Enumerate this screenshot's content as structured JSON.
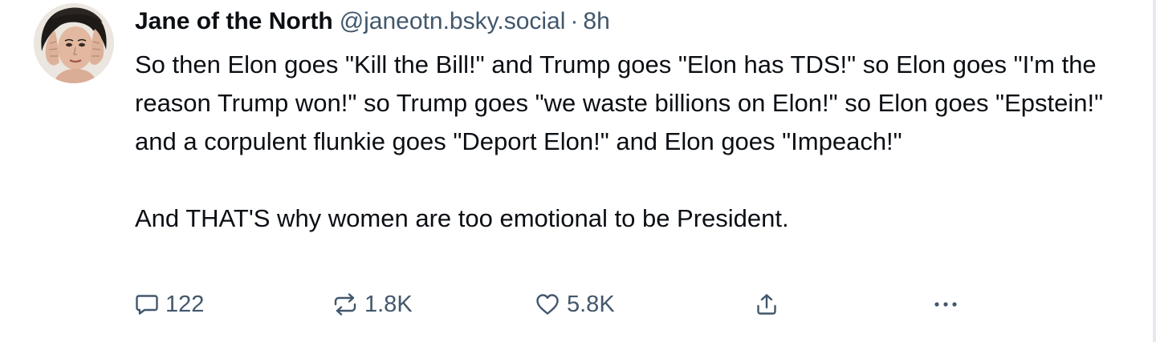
{
  "post": {
    "author": {
      "display_name": "Jane of the North",
      "handle": "@janeotn.bsky.social",
      "separator": "·",
      "time_ago": "8h"
    },
    "text": {
      "paragraph_1": "So then Elon goes \"Kill the Bill!\" and Trump goes \"Elon has TDS!\" so Elon goes \"I'm the reason Trump won!\" so Trump goes \"we waste billions on Elon!\" so Elon goes \"Epstein!\" and a corpulent flunkie goes \"Deport Elon!\" and Elon goes \"Impeach!\"",
      "paragraph_2": "And THAT'S why women are too emotional to be President."
    },
    "actions": {
      "reply": {
        "icon": "speech-bubble-icon",
        "count": "122"
      },
      "repost": {
        "icon": "repost-arrows-icon",
        "count": "1.8K"
      },
      "like": {
        "icon": "heart-icon",
        "count": "5.8K"
      },
      "share": {
        "icon": "share-upload-icon"
      },
      "more": {
        "icon": "ellipsis-icon"
      }
    }
  },
  "colors": {
    "text_primary": "#0b0f14",
    "text_secondary": "#42576c",
    "background": "#ffffff",
    "divider": "#e6e9ed"
  }
}
